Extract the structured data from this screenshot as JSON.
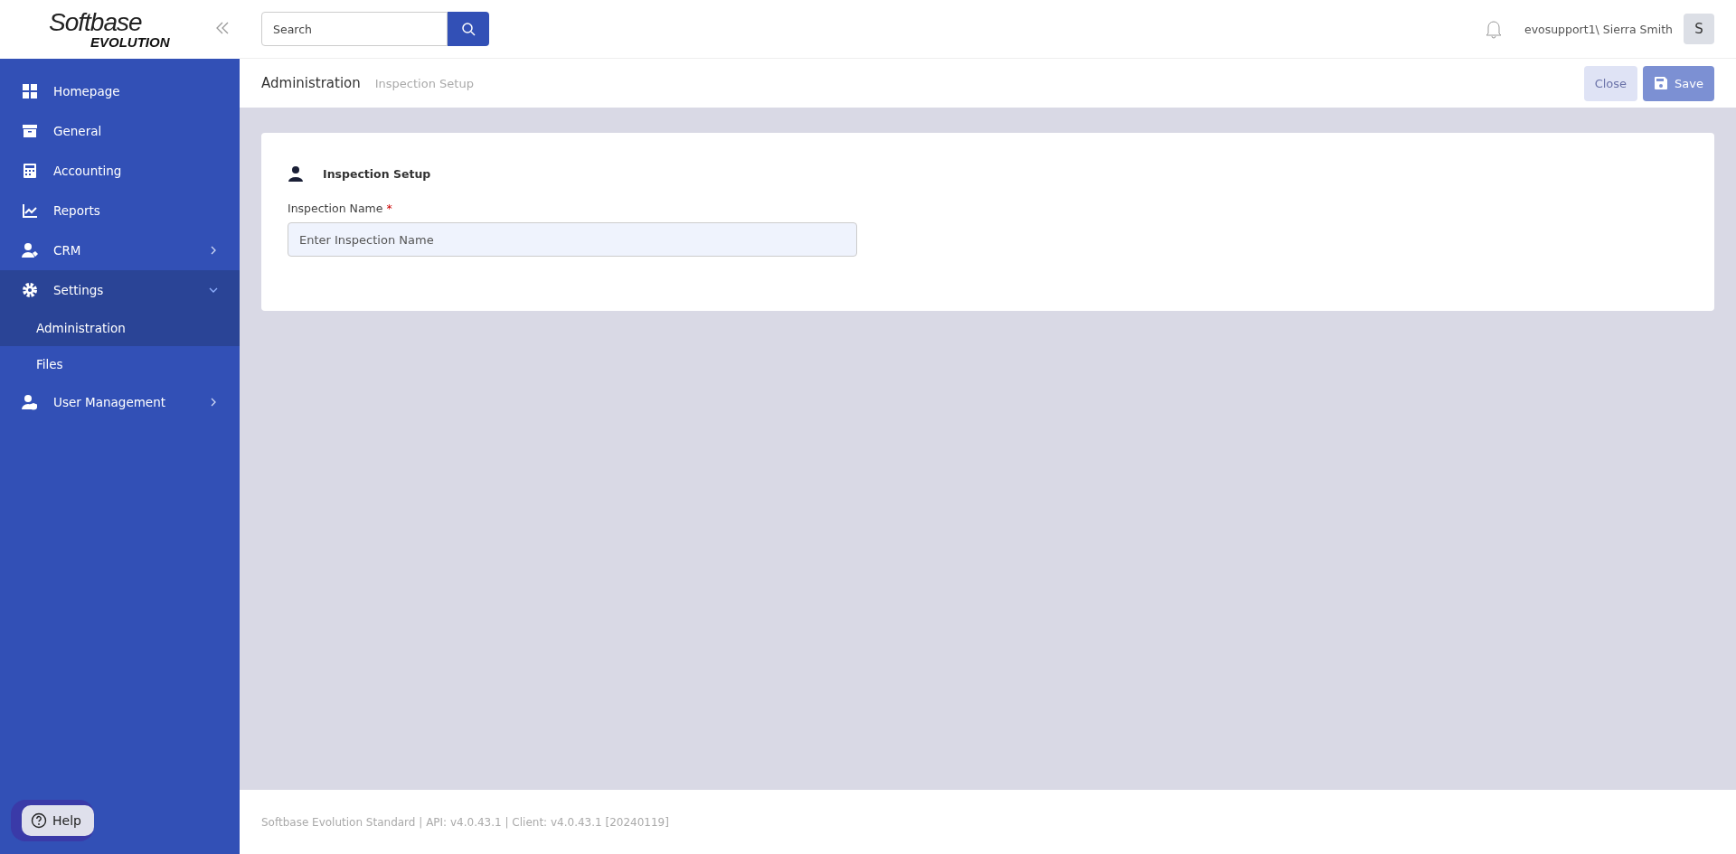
{
  "logo": {
    "line1": "Softbase",
    "line2": "EVOLUTION"
  },
  "sidebar": {
    "items": [
      {
        "label": "Homepage",
        "kind": "link"
      },
      {
        "label": "General",
        "kind": "link"
      },
      {
        "label": "Accounting",
        "kind": "link"
      },
      {
        "label": "Reports",
        "kind": "link"
      },
      {
        "label": "CRM",
        "kind": "group",
        "expanded": false
      },
      {
        "label": "Settings",
        "kind": "group",
        "expanded": true,
        "children": [
          {
            "label": "Administration",
            "selected": true
          },
          {
            "label": "Files",
            "selected": false
          }
        ]
      },
      {
        "label": "User Management",
        "kind": "group",
        "expanded": false
      }
    ]
  },
  "help": {
    "label": "Help"
  },
  "search": {
    "placeholder": "Search"
  },
  "user": {
    "name": "evosupport1\\ Sierra Smith",
    "initial": "S"
  },
  "breadcrumb": [
    "Administration",
    "Inspection Setup"
  ],
  "buttons": [
    {
      "label": "Close",
      "kind": "close"
    },
    {
      "label": "Save",
      "kind": "save"
    }
  ],
  "card": {
    "title": "Inspection Setup",
    "field": {
      "label": "Inspection Name",
      "required_mark": "*",
      "placeholder": "Enter Inspection Name"
    }
  },
  "footer": "Softbase Evolution Standard | API: v4.0.43.1 | Client: v4.0.43.1 [20240119]"
}
